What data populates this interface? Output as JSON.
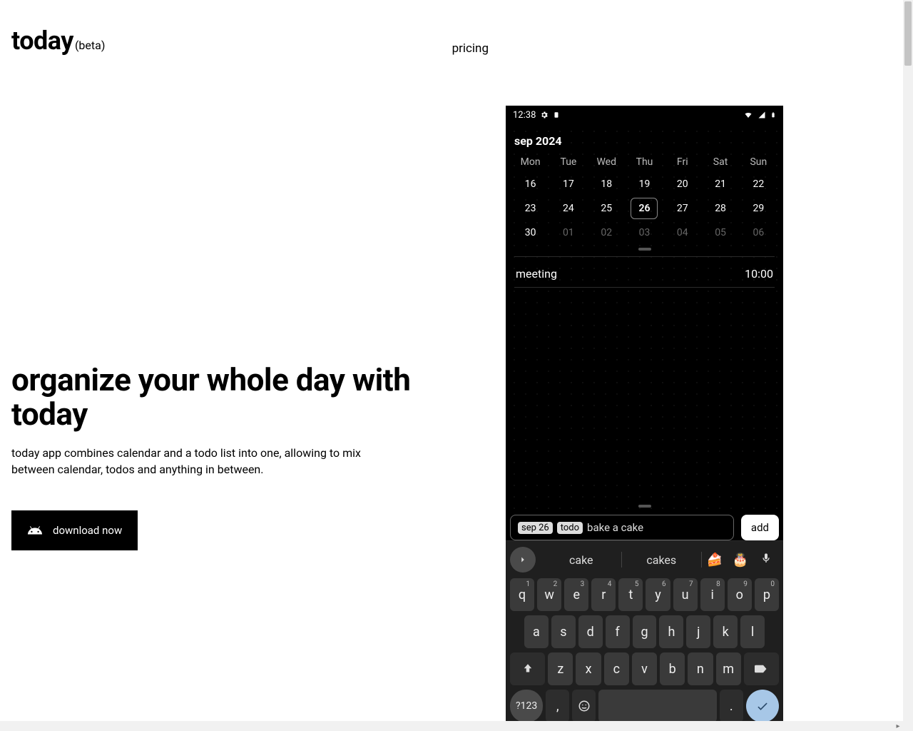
{
  "brand": {
    "name": "today",
    "tag": "(beta)"
  },
  "nav": {
    "pricing": "pricing"
  },
  "hero": {
    "title": "organize your whole day with today",
    "subtitle": "today app combines calendar and a todo list into one, allowing to mix between calendar, todos and anything in between.",
    "download": "download now"
  },
  "phone": {
    "status_time": "12:38",
    "month": "sep 2024",
    "dow": [
      "Mon",
      "Tue",
      "Wed",
      "Thu",
      "Fri",
      "Sat",
      "Sun"
    ],
    "rows": [
      [
        {
          "d": "16"
        },
        {
          "d": "17"
        },
        {
          "d": "18"
        },
        {
          "d": "19"
        },
        {
          "d": "20"
        },
        {
          "d": "21"
        },
        {
          "d": "22"
        }
      ],
      [
        {
          "d": "23"
        },
        {
          "d": "24"
        },
        {
          "d": "25"
        },
        {
          "d": "26",
          "sel": true
        },
        {
          "d": "27"
        },
        {
          "d": "28"
        },
        {
          "d": "29"
        }
      ],
      [
        {
          "d": "30"
        },
        {
          "d": "01",
          "dim": true
        },
        {
          "d": "02",
          "dim": true
        },
        {
          "d": "03",
          "dim": true
        },
        {
          "d": "04",
          "dim": true
        },
        {
          "d": "05",
          "dim": true
        },
        {
          "d": "06",
          "dim": true
        }
      ]
    ],
    "event": {
      "title": "meeting",
      "time": "10:00"
    },
    "entry": {
      "chip1": "sep 26",
      "chip2": "todo",
      "text": "bake a cake",
      "add": "add"
    },
    "suggestions": {
      "a": "cake",
      "b": "cakes",
      "e1": "🍰",
      "e2": "🎂"
    },
    "keys_r1": [
      [
        "q",
        "1"
      ],
      [
        "w",
        "2"
      ],
      [
        "e",
        "3"
      ],
      [
        "r",
        "4"
      ],
      [
        "t",
        "5"
      ],
      [
        "y",
        "6"
      ],
      [
        "u",
        "7"
      ],
      [
        "i",
        "8"
      ],
      [
        "o",
        "9"
      ],
      [
        "p",
        "0"
      ]
    ],
    "keys_r2": [
      "a",
      "s",
      "d",
      "f",
      "g",
      "h",
      "j",
      "k",
      "l"
    ],
    "keys_r3": [
      "z",
      "x",
      "c",
      "v",
      "b",
      "n",
      "m"
    ],
    "sym": "?123",
    "comma": ",",
    "period": "."
  }
}
